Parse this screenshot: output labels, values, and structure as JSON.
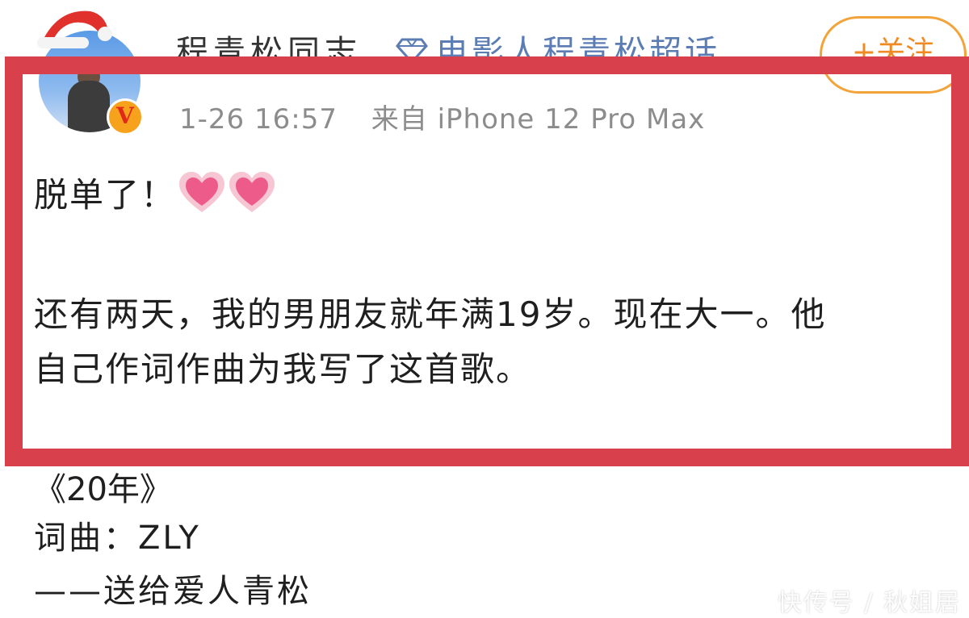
{
  "header": {
    "author_name": "程青松同志",
    "supertopic_label": "电影人程青松超话",
    "follow_label": "+关注"
  },
  "post": {
    "time": "1-26 16:57",
    "source": "来自 iPhone 12 Pro Max",
    "line1": "脱单了！",
    "line2": "还有两天，我的男朋友就年满19岁。现在大一。他",
    "line3": "自己作词作曲为我写了这首歌。",
    "song_title": "《20年》",
    "song_credit": "词曲：ZLY",
    "song_dedication": "——送给爱人青松"
  },
  "badge": {
    "verified_letter": "V"
  },
  "watermark": "快传号 / 秋姐居",
  "icons": {
    "supertopic": "diamond-icon",
    "hearts": "heart-icon",
    "hat": "santa-hat-icon"
  },
  "colors": {
    "highlight": "#d8414b",
    "link": "#5b7db3",
    "follow": "#f08a24",
    "verified": "#f7a21c"
  }
}
